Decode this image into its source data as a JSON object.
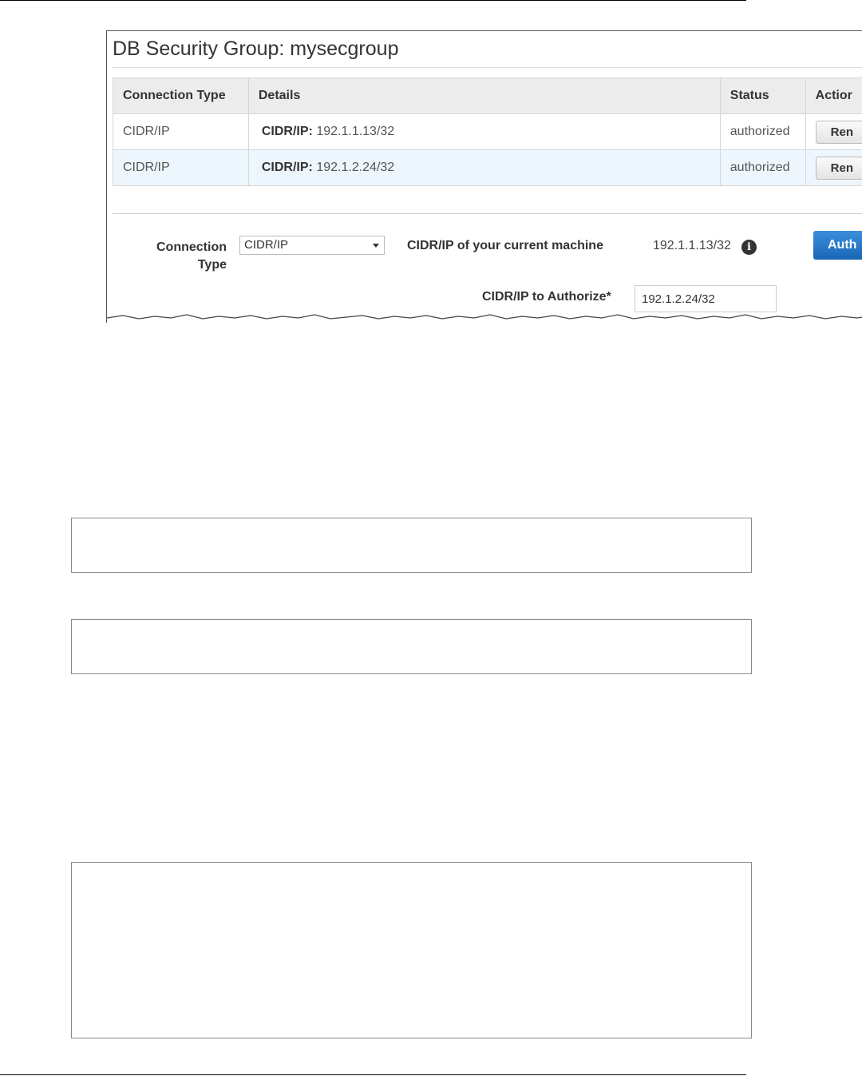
{
  "screenshot": {
    "title": "DB Security Group: mysecgroup",
    "table": {
      "headers": [
        "Connection Type",
        "Details",
        "Status",
        "Actior"
      ],
      "rows": [
        {
          "type": "CIDR/IP",
          "detail_label": "CIDR/IP:",
          "detail_value": "192.1.1.13/32",
          "status": "authorized",
          "action": "Ren"
        },
        {
          "type": "CIDR/IP",
          "detail_label": "CIDR/IP:",
          "detail_value": "192.1.2.24/32",
          "status": "authorized",
          "action": "Ren"
        }
      ]
    },
    "form": {
      "connection_type_label_1": "Connection",
      "connection_type_label_2": "Type",
      "connection_type_value": "CIDR/IP",
      "current_machine_label": "CIDR/IP of your current machine",
      "current_machine_value": "192.1.1.13/32",
      "info_glyph": "i",
      "authorize_button": "Auth",
      "authorize_label": "CIDR/IP to Authorize*",
      "authorize_value": "192.1.2.24/32"
    },
    "colors": {
      "status": "#2ea84a",
      "primary_button": "#1a66b8"
    }
  }
}
